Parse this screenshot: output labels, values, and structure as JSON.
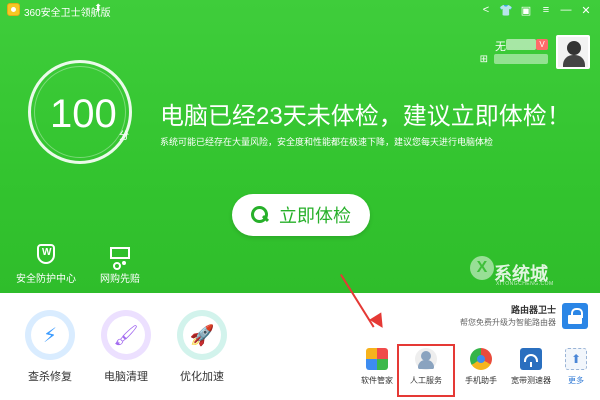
{
  "app": {
    "title": "360安全卫士领航版",
    "title_arrow": "⬆"
  },
  "titlebar_icons": [
    {
      "name": "share-icon",
      "glyph": "<"
    },
    {
      "name": "shirt-icon",
      "glyph": "👕"
    },
    {
      "name": "grid-icon",
      "glyph": "▣"
    },
    {
      "name": "menu-icon",
      "glyph": "≡"
    },
    {
      "name": "minimize-icon",
      "glyph": "—"
    },
    {
      "name": "close-icon",
      "glyph": "✕"
    }
  ],
  "user": {
    "name_prefix": "无",
    "vip": "V",
    "gift_glyph": "⊞"
  },
  "score": {
    "value": "100",
    "unit": "分"
  },
  "headline": "电脑已经23天未体检，建议立即体检！",
  "subline": "系统可能已经存在大量风险，安全度和性能都在极速下降，建议您每天进行电脑体检",
  "check_button": {
    "label": "立即体检"
  },
  "quick_links": [
    {
      "label": "安全防护中心"
    },
    {
      "label": "网购先赔"
    }
  ],
  "watermark": {
    "brand": "系统城",
    "logo_letter": "X",
    "sub": "XITONGCHENG.COM"
  },
  "features": [
    {
      "label": "查杀修复",
      "glyph": "⚡",
      "color": "#4aa6ff",
      "ring": "#cfe6ff"
    },
    {
      "label": "电脑清理",
      "glyph": "🖌",
      "color": "#a36bf0",
      "ring": "#e6d6ff"
    },
    {
      "label": "优化加速",
      "glyph": "🚀",
      "color": "#19b7a0",
      "ring": "#c8f1ea"
    }
  ],
  "router": {
    "title": "路由器卫士",
    "desc": "帮您免费升级为智能路由器"
  },
  "apps": [
    {
      "label": "软件管家"
    },
    {
      "label": "人工服务"
    },
    {
      "label": "手机助手"
    },
    {
      "label": "宽带测速器"
    },
    {
      "label": "更多"
    }
  ]
}
